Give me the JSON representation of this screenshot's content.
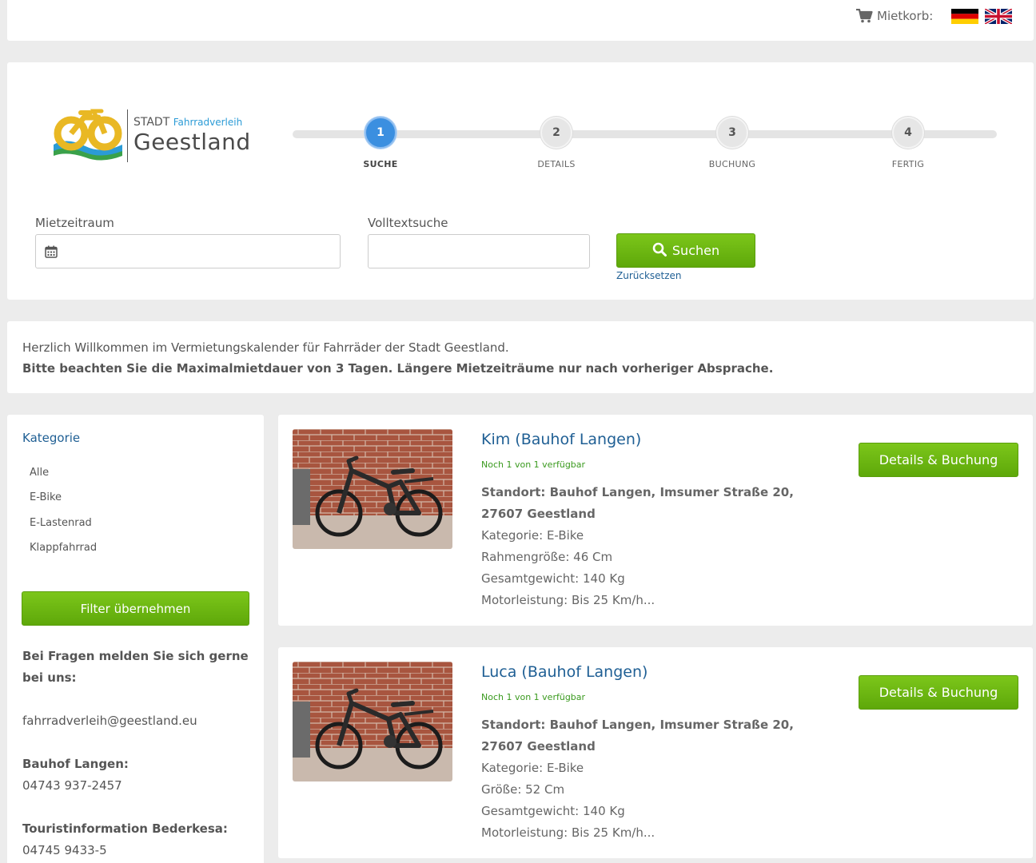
{
  "header": {
    "cart_label": "Mietkorb:",
    "cart_icon": "shopping-cart-icon",
    "languages": [
      "de",
      "en"
    ]
  },
  "logo": {
    "prefix": "STADT",
    "suffix": "Fahrradverleih",
    "name": "Geestland"
  },
  "steps": [
    {
      "number": "1",
      "label": "SUCHE",
      "active": true
    },
    {
      "number": "2",
      "label": "DETAILS",
      "active": false
    },
    {
      "number": "3",
      "label": "BUCHUNG",
      "active": false
    },
    {
      "number": "4",
      "label": "FERTIG",
      "active": false
    }
  ],
  "search": {
    "period_label": "Mietzeitraum",
    "period_value": "",
    "fulltext_label": "Volltextsuche",
    "fulltext_value": "",
    "button_label": "Suchen",
    "reset_label": "Zurücksetzen"
  },
  "welcome": {
    "line1": "Herzlich Willkommen im Vermietungskalender für Fahrräder der Stadt Geestland.",
    "line2": "Bitte beachten Sie die Maximalmietdauer von 3 Tagen. Längere Mietzeiträume nur nach vorheriger Absprache."
  },
  "sidebar": {
    "category_title": "Kategorie",
    "categories": [
      "Alle",
      "E-Bike",
      "E-Lastenrad",
      "Klappfahrrad"
    ],
    "filter_button": "Filter übernehmen",
    "questions_line1": "Bei Fragen melden Sie sich gerne",
    "questions_line2": "bei uns:",
    "email": "fahrradverleih@geestland.eu",
    "contact1_title": "Bauhof Langen:",
    "contact1_phone": "04743 937-2457",
    "contact2_title": "Touristinformation Bederkesa:",
    "contact2_phone": "04745 9433-5"
  },
  "products": [
    {
      "title": "Kim (Bauhof Langen)",
      "availability": "Noch 1 von 1 verfügbar",
      "location": "Standort: Bauhof Langen, Imsumer Straße 20, 27607 Geestland",
      "details": [
        "Kategorie: E-Bike",
        "Rahmengröße: 46 Cm",
        "Gesamtgewicht: 140 Kg",
        "Motorleistung: Bis 25 Km/h..."
      ],
      "button": "Details & Buchung"
    },
    {
      "title": "Luca (Bauhof Langen)",
      "availability": "Noch 1 von 1 verfügbar",
      "location": "Standort: Bauhof Langen, Imsumer Straße 20, 27607 Geestland",
      "details": [
        "Kategorie: E-Bike",
        "Größe: 52 Cm",
        "Gesamtgewicht: 140 Kg",
        "Motorleistung: Bis 25 Km/h..."
      ],
      "button": "Details & Buchung"
    }
  ],
  "colors": {
    "accent_green": "#6ab512",
    "link_blue": "#1f5f94",
    "step_active": "#3b8fe0",
    "availability_green": "#3a9a1e"
  }
}
